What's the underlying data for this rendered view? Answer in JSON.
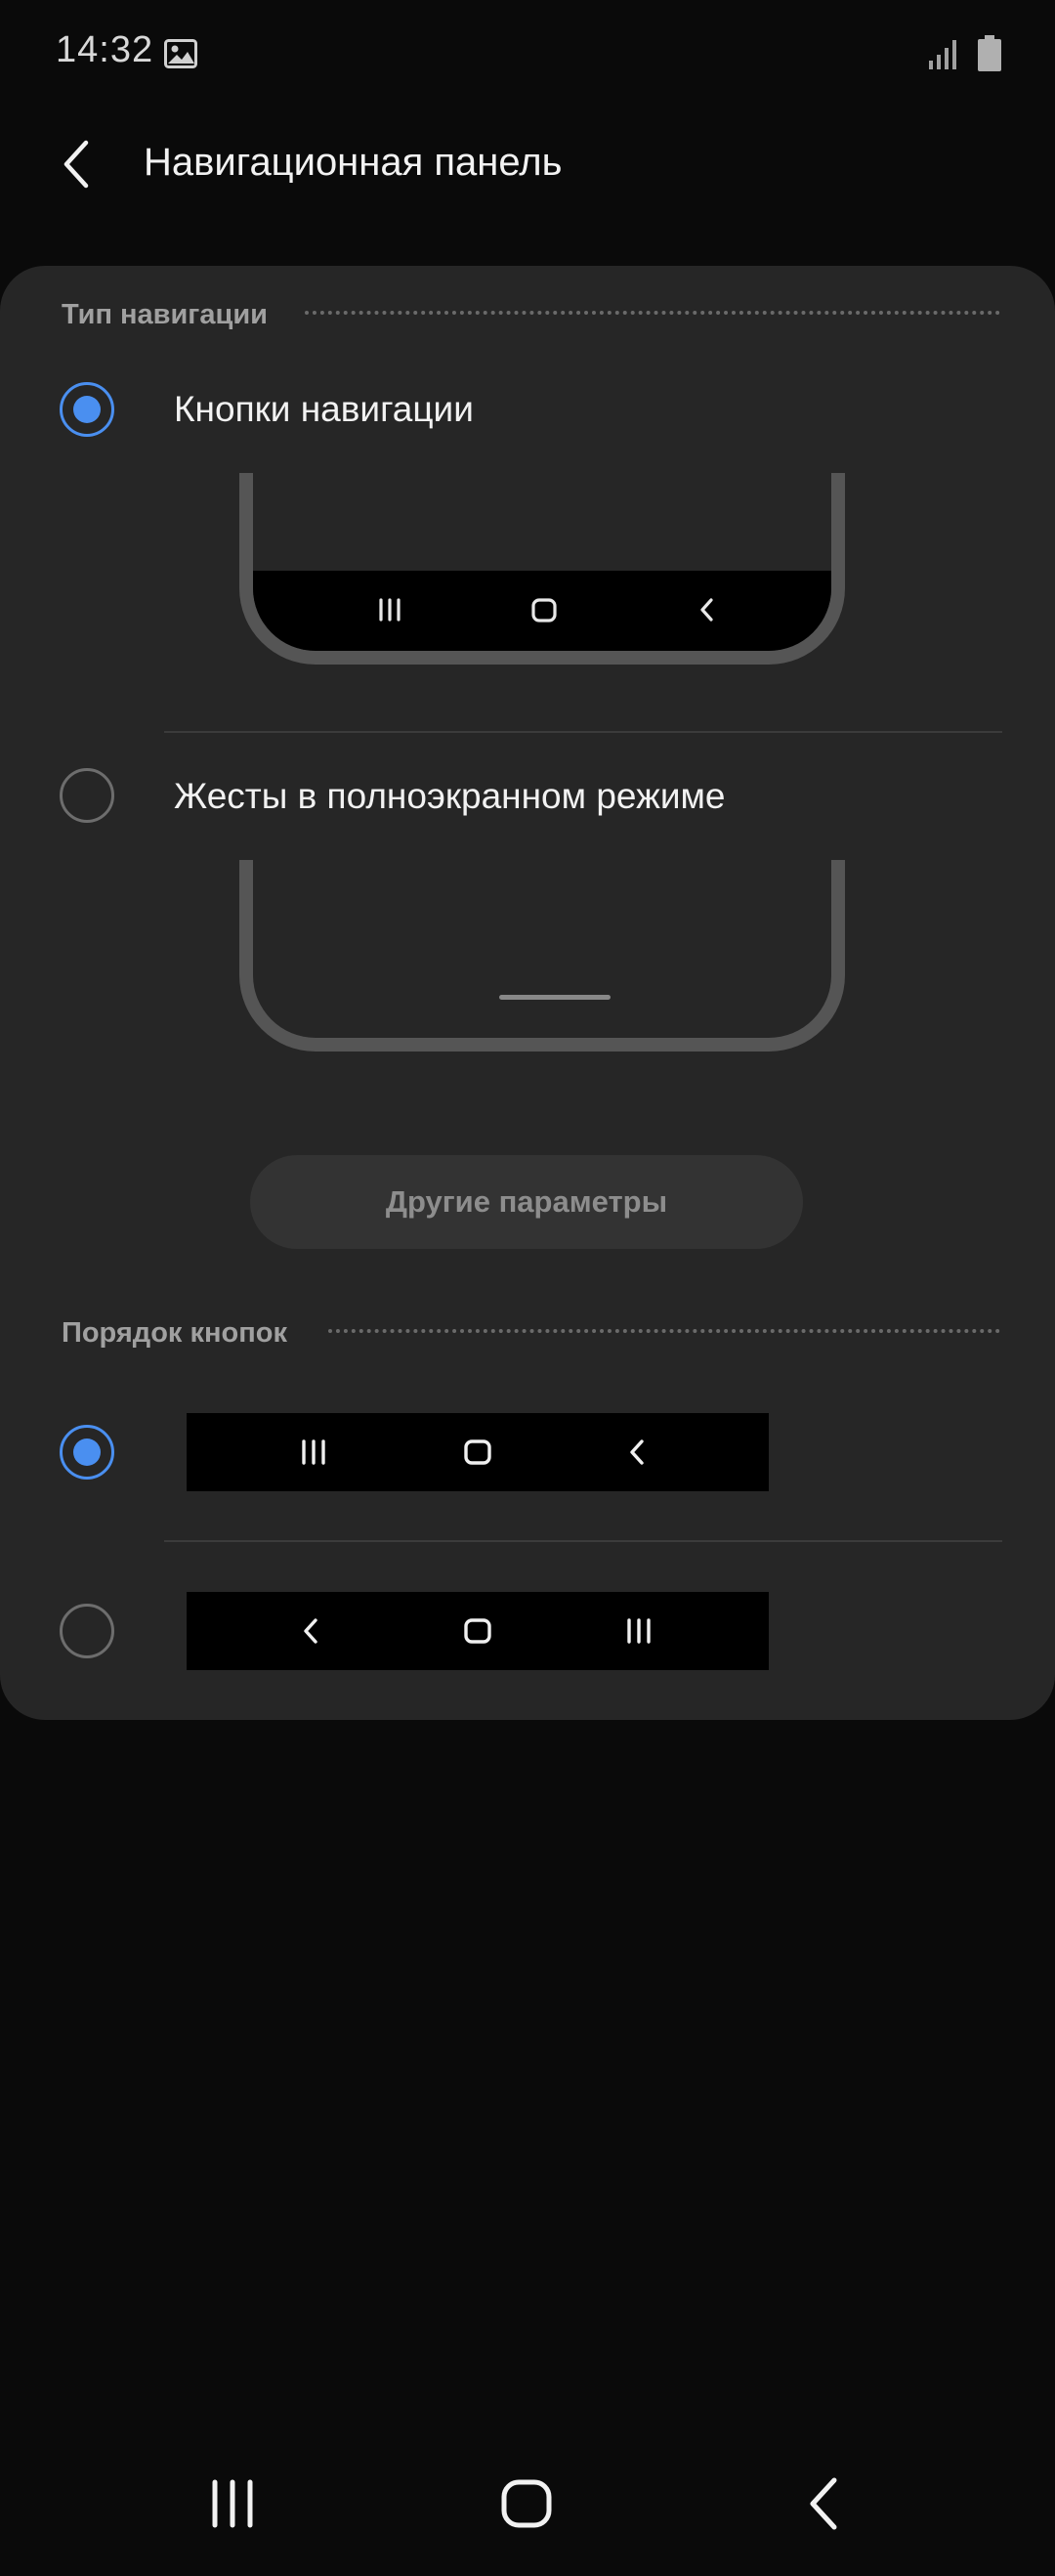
{
  "status_bar": {
    "time": "14:32",
    "icons": [
      "gallery-icon",
      "signal-icon",
      "battery-icon"
    ]
  },
  "header": {
    "back_icon": "back-icon",
    "title": "Навигационная панель"
  },
  "navigation_type": {
    "section_title": "Тип навигации",
    "options": [
      {
        "label": "Кнопки навигации",
        "selected": true
      },
      {
        "label": "Жесты в полноэкранном режиме",
        "selected": false
      }
    ],
    "more_button_label": "Другие параметры"
  },
  "button_order": {
    "section_title": "Порядок кнопок",
    "options": [
      {
        "buttons": [
          "recents-icon",
          "home-icon",
          "back-icon"
        ],
        "selected": true
      },
      {
        "buttons": [
          "back-icon",
          "home-icon",
          "recents-icon"
        ],
        "selected": false
      }
    ]
  },
  "system_nav": {
    "buttons": [
      "recents-icon",
      "home-icon",
      "back-icon"
    ]
  },
  "colors": {
    "background": "#0a0a0a",
    "card": "#262626",
    "accent": "#4a8ff0",
    "section_title": "#a0a0a0"
  }
}
